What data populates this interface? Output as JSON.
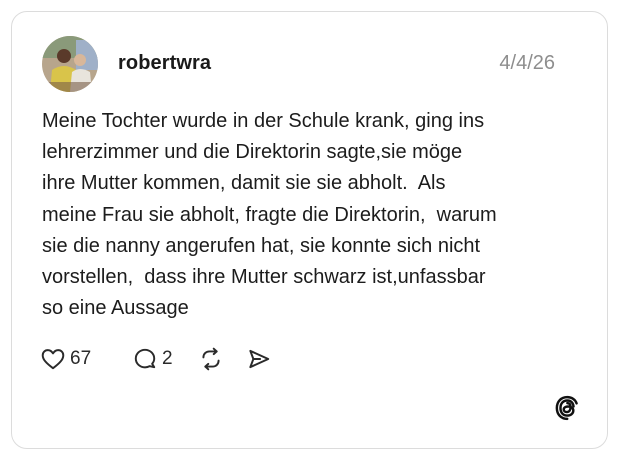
{
  "post": {
    "username": "robertwra",
    "date": "4/4/26",
    "text_lines": [
      "Meine Tochter wurde in der Schule krank, ging ins",
      "lehrerzimmer und die Direktorin sagte,sie möge",
      "ihre Mutter kommen, damit sie sie abholt.  Als",
      "meine Frau sie abholt, fragte die Direktorin,  warum",
      "sie die nanny angerufen hat, sie konnte sich nicht",
      "vorstellen,  dass ihre Mutter schwarz ist,unfassbar",
      "so eine Aussage"
    ]
  },
  "actions": {
    "like": {
      "icon": "heart-icon",
      "count": "67"
    },
    "reply": {
      "icon": "comment-icon",
      "count": "2"
    },
    "repost": {
      "icon": "repost-icon"
    },
    "share": {
      "icon": "send-icon"
    }
  },
  "branding": {
    "icon": "threads-logo-icon"
  },
  "colors": {
    "border": "#dcdcdc",
    "text": "#1c1c1c",
    "muted": "#8e8e8e",
    "background": "#ffffff"
  }
}
